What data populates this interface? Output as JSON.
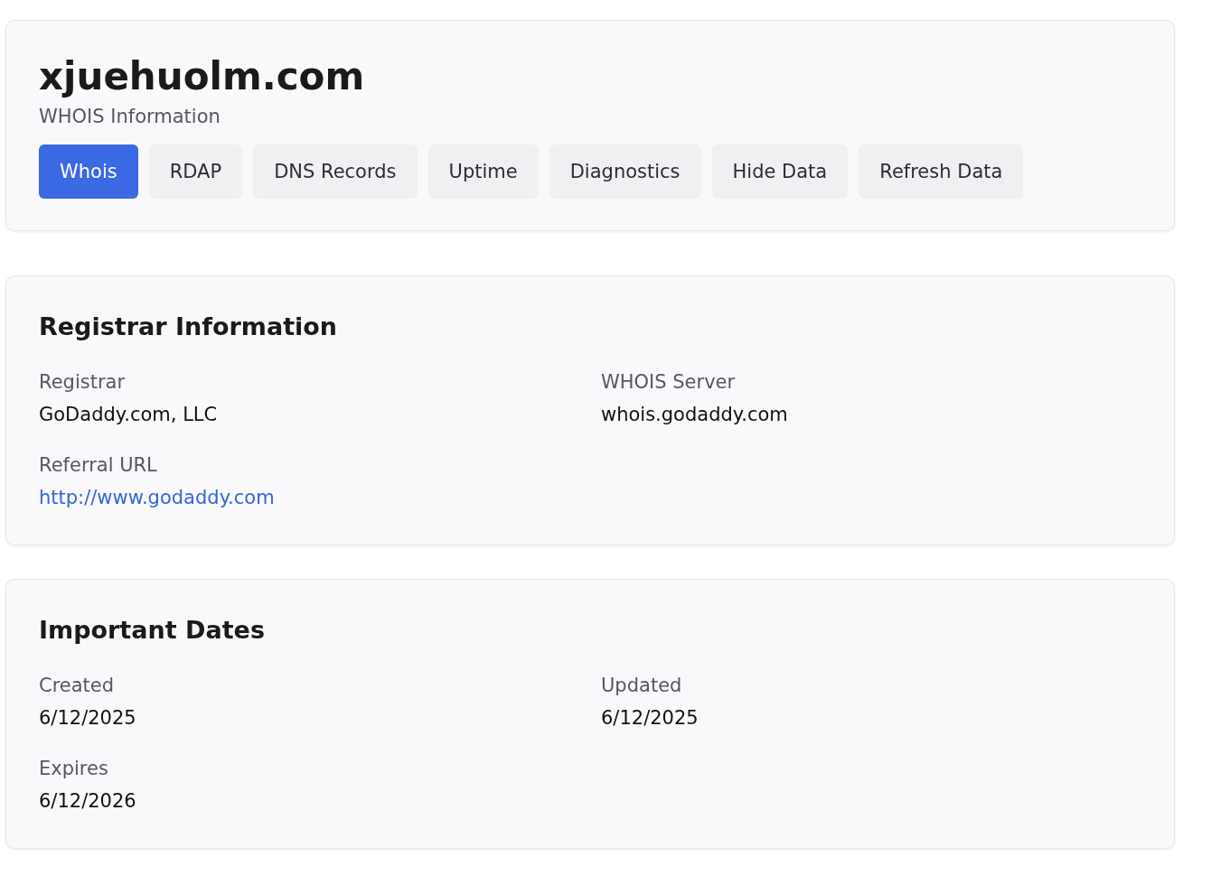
{
  "header": {
    "title": "xjuehuolm.com",
    "subtitle": "WHOIS Information",
    "tabs": [
      {
        "label": "Whois",
        "selected": true
      },
      {
        "label": "RDAP",
        "selected": false
      },
      {
        "label": "DNS Records",
        "selected": false
      },
      {
        "label": "Uptime",
        "selected": false
      },
      {
        "label": "Diagnostics",
        "selected": false
      },
      {
        "label": "Hide Data",
        "selected": false
      },
      {
        "label": "Refresh Data",
        "selected": false
      }
    ]
  },
  "sections": [
    {
      "title": "Registrar Information",
      "fields": [
        {
          "label": "Registrar",
          "value": "GoDaddy.com, LLC",
          "kind": "text"
        },
        {
          "label": "WHOIS Server",
          "value": "whois.godaddy.com",
          "kind": "text"
        },
        {
          "label": "Referral URL",
          "value": "http://www.godaddy.com",
          "kind": "link"
        }
      ]
    },
    {
      "title": "Important Dates",
      "fields": [
        {
          "label": "Created",
          "value": "6/12/2025",
          "kind": "text"
        },
        {
          "label": "Updated",
          "value": "6/12/2025",
          "kind": "text"
        },
        {
          "label": "Expires",
          "value": "6/12/2026",
          "kind": "text"
        }
      ]
    }
  ]
}
